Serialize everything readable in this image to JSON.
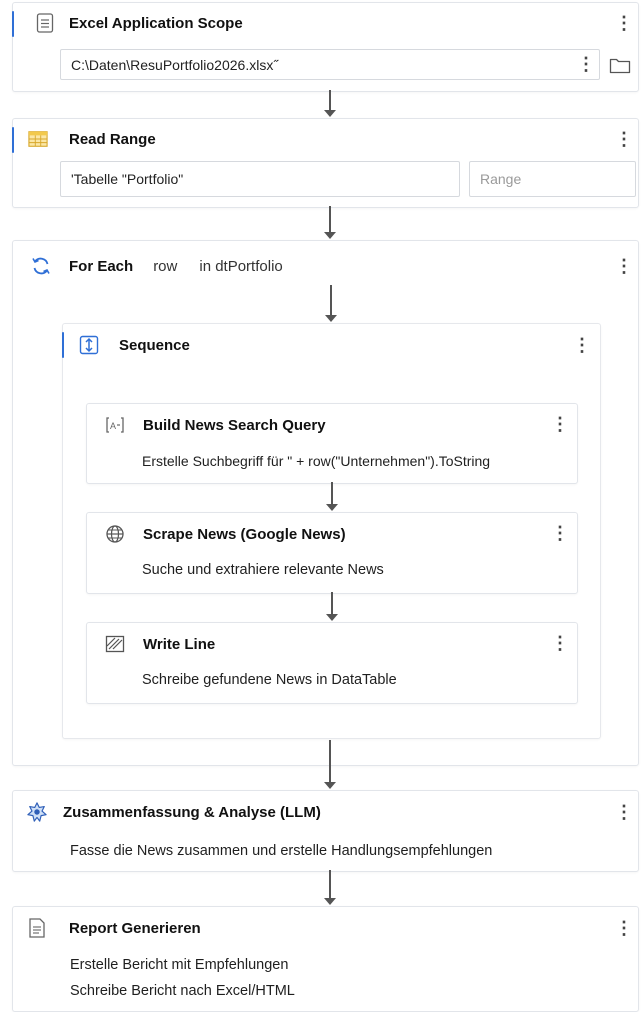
{
  "excel_scope": {
    "title": "Excel Application Scope",
    "path": "C:\\Daten\\ResuPortfolio2026.xlsx˝"
  },
  "read_range": {
    "title": "Read Range",
    "sheet": "'Tabelle \"Portfolio\"",
    "range_placeholder": "Range"
  },
  "for_each": {
    "title": "For Each",
    "item": "row",
    "in_text": "in dtPortfolio"
  },
  "sequence": {
    "title": "Sequence",
    "activities": [
      {
        "title": "Build News Search Query",
        "desc": "Erstelle Suchbegriff für \" + row(\"Unternehmen\").ToString"
      },
      {
        "title": "Scrape News (Google News)",
        "desc": "Suche und extrahiere relevante News"
      },
      {
        "title": "Write Line",
        "desc": "Schreibe gefundene News in DataTable"
      }
    ]
  },
  "llm": {
    "title": "Zusammenfassung & Analyse (LLM)",
    "desc": "Fasse die News zusammen und erstelle Handlungsempfehlungen"
  },
  "report": {
    "title": "Report Generieren",
    "line1": "Erstelle Bericht mit Empfehlungen",
    "line2": "Schreibe Bericht nach Excel/HTML"
  },
  "kebab_glyph": "⋮",
  "colors": {
    "accent": "#2f6fd6",
    "border": "#e2e5ea"
  }
}
